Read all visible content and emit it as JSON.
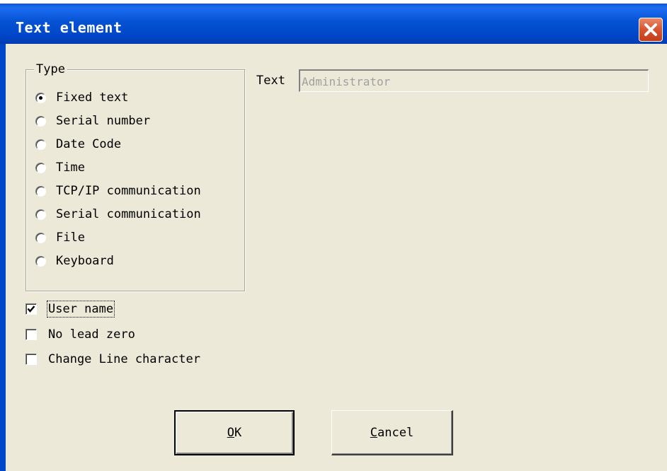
{
  "window": {
    "title": "Text element"
  },
  "type_group": {
    "title": "Type",
    "options": [
      {
        "label": "Fixed text",
        "checked": true
      },
      {
        "label": "Serial number",
        "checked": false
      },
      {
        "label": "Date Code",
        "checked": false
      },
      {
        "label": "Time",
        "checked": false
      },
      {
        "label": "TCP/IP communication",
        "checked": false
      },
      {
        "label": "Serial communication",
        "checked": false
      },
      {
        "label": "File",
        "checked": false
      },
      {
        "label": "Keyboard",
        "checked": false
      }
    ]
  },
  "text_field": {
    "label": "Text",
    "value": "Administrator"
  },
  "checkboxes": [
    {
      "label": "User name",
      "checked": true
    },
    {
      "label": "No lead zero",
      "checked": false
    },
    {
      "label": "Change Line character",
      "checked": false
    }
  ],
  "buttons": {
    "ok_mnemonic": "O",
    "ok_rest": "K",
    "cancel_mnemonic": "C",
    "cancel_rest": "ancel"
  },
  "colors": {
    "titlebar": "#0552d4",
    "dialog_bg": "#ece9d8",
    "close_button": "#d8532e"
  }
}
